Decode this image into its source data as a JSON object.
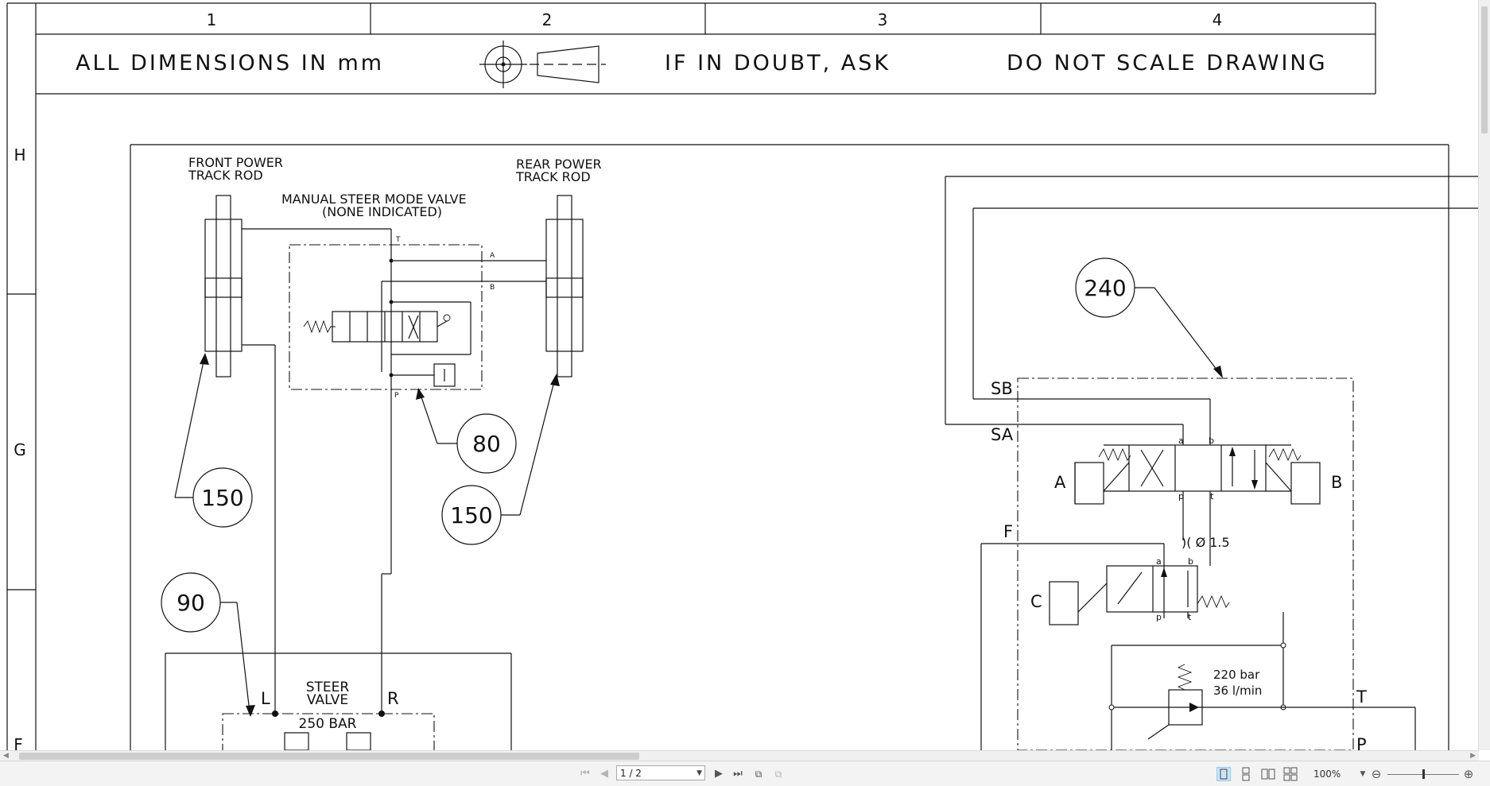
{
  "drawing": {
    "columns": [
      "1",
      "2",
      "3",
      "4"
    ],
    "rows": [
      "H",
      "G",
      "F"
    ],
    "title_block": {
      "dimensions": "ALL DIMENSIONS IN mm",
      "doubt": "IF IN DOUBT, ASK",
      "scale": "DO NOT SCALE DRAWING"
    },
    "labels": {
      "front_power_1": "FRONT POWER",
      "front_power_2": "TRACK ROD",
      "rear_power_1": "REAR POWER",
      "rear_power_2": "TRACK ROD",
      "manual_valve_1": "MANUAL STEER MODE VALVE",
      "manual_valve_2": "(NONE INDICATED)",
      "steer_valve_1": "STEER",
      "steer_valve_2": "VALVE",
      "bar_250": "250 BAR",
      "port_l": "L",
      "port_r": "R",
      "port_t_small": "T",
      "port_a_small": "A",
      "port_b_small": "B",
      "port_p_small": "P",
      "sb": "SB",
      "sa": "SA",
      "f": "F",
      "a": "A",
      "b": "B",
      "c": "C",
      "t": "T",
      "p": "P",
      "lower_a": "a",
      "lower_b": "b",
      "lower_p": "p",
      "lower_t": "t",
      "orifice": ")( Ø 1.5",
      "relief_1": "220 bar",
      "relief_2": "36 l/min"
    },
    "balloons": [
      "240",
      "80",
      "150",
      "150",
      "90"
    ]
  },
  "toolbar": {
    "first_page": "first-page-icon",
    "prev_page": "previous-page-icon",
    "page_value": "1 / 2",
    "next_page": "next-page-icon",
    "last_page": "last-page-icon",
    "zoom": "100%",
    "zoom_out": "⊖",
    "zoom_in": "⊕"
  },
  "colors": {
    "line": "#111111",
    "toolbar_bg": "#f3f3f3",
    "active_view": "#cce4f7"
  }
}
